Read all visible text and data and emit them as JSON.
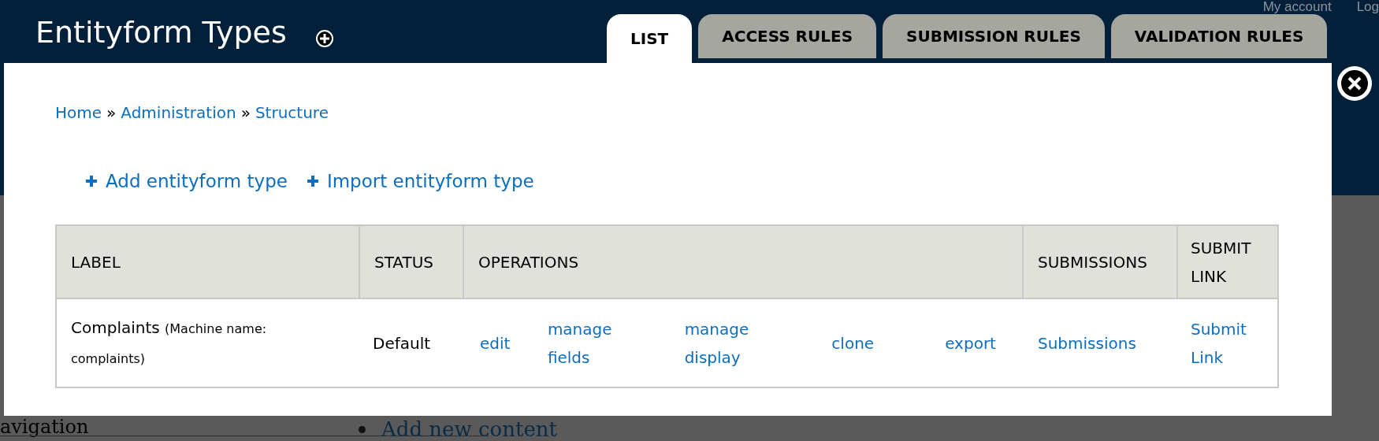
{
  "header": {
    "title": "Entityform Types",
    "user_links": [
      "My account",
      "Log"
    ]
  },
  "tabs": [
    {
      "label": "LIST",
      "selected": true
    },
    {
      "label": "ACCESS RULES",
      "selected": false
    },
    {
      "label": "SUBMISSION RULES",
      "selected": false
    },
    {
      "label": "VALIDATION RULES",
      "selected": false
    }
  ],
  "breadcrumb": {
    "items": [
      "Home",
      "Administration",
      "Structure"
    ],
    "separator": "»"
  },
  "actions": [
    "Add entityform type",
    "Import entityform type"
  ],
  "table": {
    "columns": [
      "LABEL",
      "STATUS",
      "OPERATIONS",
      "SUBMISSIONS",
      "SUBMIT LINK"
    ],
    "rows": [
      {
        "label": "Complaints",
        "machine_name": "(Machine name: complaints)",
        "status": "Default",
        "operations": [
          "edit",
          "manage fields",
          "manage display",
          "clone",
          "export"
        ],
        "submissions": "Submissions",
        "submit_link": "Submit Link"
      }
    ]
  },
  "background": {
    "sidebar_heading": "avigation",
    "content_links": [
      "Add new content"
    ]
  }
}
